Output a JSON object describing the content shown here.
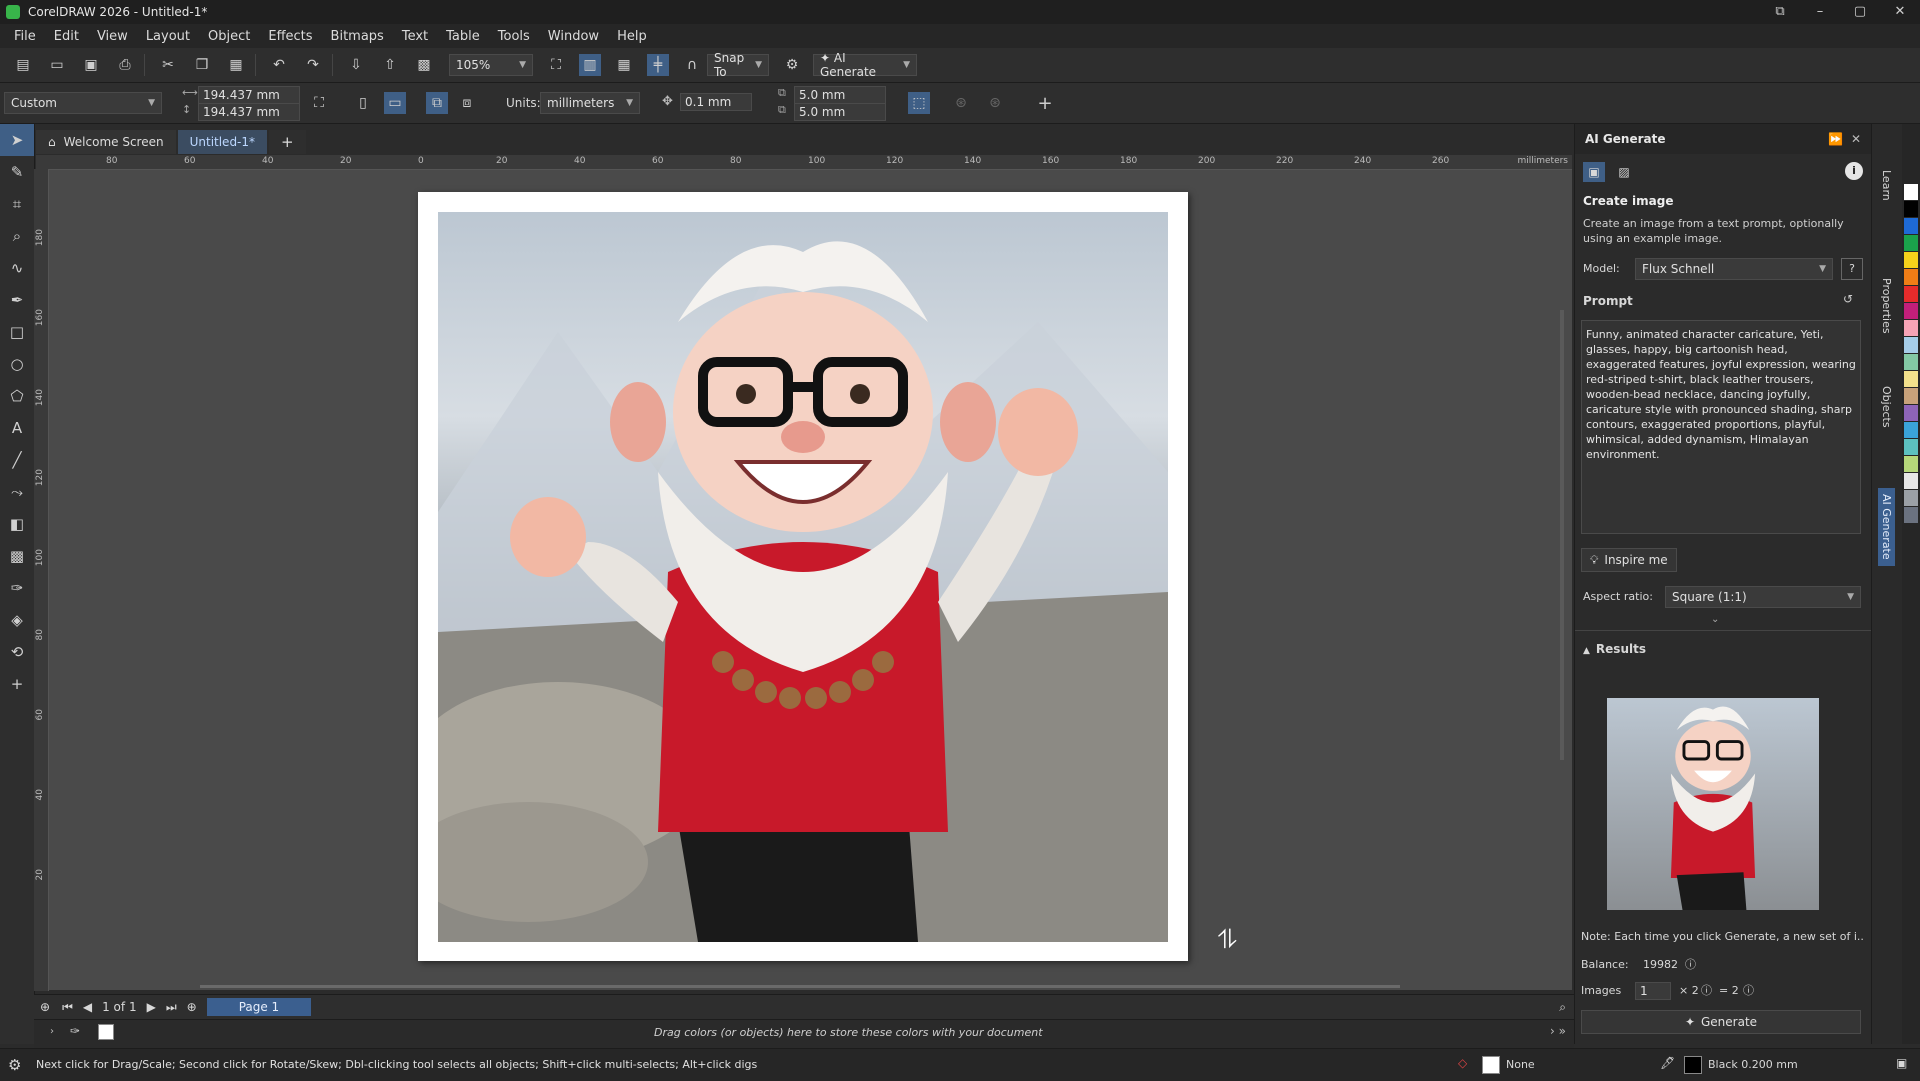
{
  "window": {
    "title": "CorelDRAW 2026 - Untitled-1*"
  },
  "menu": [
    "File",
    "Edit",
    "View",
    "Layout",
    "Object",
    "Effects",
    "Bitmaps",
    "Text",
    "Table",
    "Tools",
    "Window",
    "Help"
  ],
  "toolbar": {
    "zoom": "105%",
    "snap_to": "Snap To",
    "ai_generate": "AI Generate"
  },
  "propbar": {
    "preset": "Custom",
    "width": "194.437 mm",
    "height": "194.437 mm",
    "units_label": "Units:",
    "units_value": "millimeters",
    "nudge": "0.1 mm",
    "dup_x": "5.0 mm",
    "dup_y": "5.0 mm"
  },
  "tabs": {
    "welcome": "Welcome Screen",
    "document": "Untitled-1*"
  },
  "ruler": {
    "units": "millimeters",
    "h_ticks": [
      "80",
      "60",
      "40",
      "20",
      "0",
      "20",
      "40",
      "60",
      "80",
      "100",
      "120",
      "140",
      "160",
      "180",
      "200",
      "220",
      "240",
      "260"
    ],
    "v_ticks": [
      "180",
      "160",
      "140",
      "120",
      "100",
      "80",
      "60",
      "40",
      "20"
    ]
  },
  "panel": {
    "title": "AI Generate",
    "section_title": "Create image",
    "section_desc": "Create an image from a text prompt, optionally using an example image.",
    "model_label": "Model:",
    "model_value": "Flux Schnell",
    "prompt_label": "Prompt",
    "prompt_text": "Funny, animated character caricature, Yeti, glasses, happy, big cartoonish head, exaggerated features, joyful expression, wearing red-striped t-shirt, black leather trousers, wooden-bead necklace, dancing joyfully, caricature style with pronounced shading, sharp contours, exaggerated proportions, playful, whimsical, added dynamism, Himalayan environment.",
    "inspire_label": "Inspire me",
    "aspect_label": "Aspect ratio:",
    "aspect_value": "Square (1:1)",
    "results_label": "Results",
    "note": "Note: Each time you click Generate, a new set of i...",
    "balance_label": "Balance:",
    "balance_value": "19982",
    "images_label": "Images",
    "images_value": "1",
    "multiplier": "× 2",
    "equals": "= 2",
    "generate_label": "Generate"
  },
  "dock_tabs": [
    "Learn",
    "Properties",
    "Objects",
    "AI Generate"
  ],
  "docbar": {
    "page_info": "1 of 1",
    "page_tab": "Page 1"
  },
  "colorbar": {
    "hint": "Drag colors (or objects) here to store these colors with your document"
  },
  "status": {
    "hint": "Next click for Drag/Scale; Second click for Rotate/Skew; Dbl-clicking tool selects all objects; Shift+click multi-selects; Alt+click digs",
    "fill": "None",
    "outline": "Black  0.200 mm"
  },
  "palette_colors": [
    "#ffffff",
    "#000000",
    "#1e6ad6",
    "#1aa24b",
    "#f5d21b",
    "#ef7d16",
    "#e52b2b",
    "#c21f7a",
    "#f7a3b6",
    "#a6cde8",
    "#83c8a4",
    "#f2e08b",
    "#c7a17a",
    "#8e64b8",
    "#3aa3d9",
    "#5cc1c0",
    "#b5d77a",
    "#e6e6e6",
    "#9ba0a6",
    "#6b7280"
  ]
}
